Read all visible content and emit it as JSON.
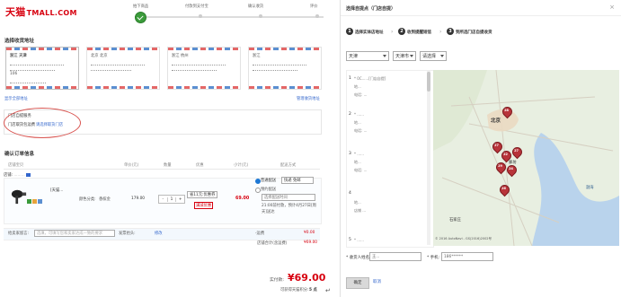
{
  "checkout": {
    "logo_cn": "天猫",
    "logo_en": "TMALL.COM",
    "steps": [
      "拍下商品",
      "付款到支付宝",
      "确认收货",
      "评价"
    ],
    "section_address": "选择收货地址",
    "address_cards": [
      {
        "line1": "浙江 天津",
        "line2": "天津",
        "line3": "106"
      },
      {
        "line1": "北京 北京",
        "line2": "",
        "line3": ""
      },
      {
        "line1": "浙江 杭州",
        "line2": "",
        "line3": ""
      },
      {
        "line1": "浙江",
        "line2": "",
        "line3": ""
      }
    ],
    "show_all_addresses": "显示全部地址",
    "manage_addresses": "管理收货地址",
    "store_service_title": "门店自提服务",
    "store_service_desc": "门店取货包运费",
    "store_service_link": "请选择取货门店",
    "section_confirm": "确认订单信息",
    "table_headers": [
      "店铺宝贝",
      "单价(元)",
      "数量",
      "优惠",
      "小计(元)",
      "配送方式"
    ],
    "store_label": "店铺:",
    "item_title": "[天猫...",
    "item_color_label": "颜色分类:",
    "item_color_value": "香槟金",
    "item_price": "179.00",
    "item_qty": "1",
    "item_discount_select": "省11元:优惠券",
    "item_discount_tag": "满减优惠",
    "item_subtotal": "69.00",
    "ship_standard": "普通配送",
    "ship_express": "快递 免邮",
    "ship_scheduled": "预约配送",
    "ship_time_placeholder": "选择配送时间",
    "ship_note1": "21:00前付款，预计4月27日[周",
    "ship_note2": "天]送达",
    "msg_label": "给卖家留言:",
    "msg_placeholder": "选填，可填写您和卖家达成一致的要求",
    "invoice_label": "发票抬头:",
    "invoice_action": "修改",
    "store_total_label": "店铺合计(含运费)",
    "store_total_value": "¥69.00",
    "store_total_shipping": "¥0.00",
    "total_label": "实付款:",
    "total_amount": "¥69.00",
    "points_label": "可获得天猫积分:",
    "points_value": "5 点"
  },
  "dialog": {
    "title": "选择自提点（门店自提）",
    "close": "×",
    "steps": [
      {
        "num": "1",
        "label": "选择实体店地址"
      },
      {
        "num": "2",
        "label": "收到提醒短信"
      },
      {
        "num": "3",
        "label": "到所选门店自提收货"
      }
    ],
    "province": "天津",
    "city": "天津市",
    "district": "请选择",
    "stores": [
      {
        "num": "1",
        "line1": "* 0C......[门店自提]",
        "line2": "地...",
        "line3": "电话: ..."
      },
      {
        "num": "2",
        "line1": "* ......",
        "line2": "地...",
        "line3": "电话: ..."
      },
      {
        "num": "3",
        "line1": "* ......",
        "line2": "地...",
        "line3": "电话: ..."
      },
      {
        "num": "4",
        "line1": "",
        "line2": "地...",
        "line3": "店铺 ..."
      },
      {
        "num": "5",
        "line1": "* ......",
        "line2": "",
        "line3": ""
      }
    ],
    "map_labels": {
      "beijing": "北京",
      "bohai": "渤海",
      "shijiazhuang": "石家庄",
      "langfang": "廊坊",
      "copyright": "© 2016 AutoNavi - GS(2016)2002号"
    },
    "pins": [
      "28",
      "27",
      "27",
      "22",
      "29",
      "24",
      "26"
    ],
    "form_name_label": "* 收货人姓名:",
    "form_name_value": "王...",
    "form_phone_label": "* 手机:",
    "form_phone_value": "186******",
    "confirm_btn": "确定",
    "cancel_link": "取消"
  },
  "colors": {
    "brand_red": "#d7000f",
    "step_green": "#3b9b3b",
    "pin_red": "#b8343a",
    "link_blue": "#3366cc"
  }
}
